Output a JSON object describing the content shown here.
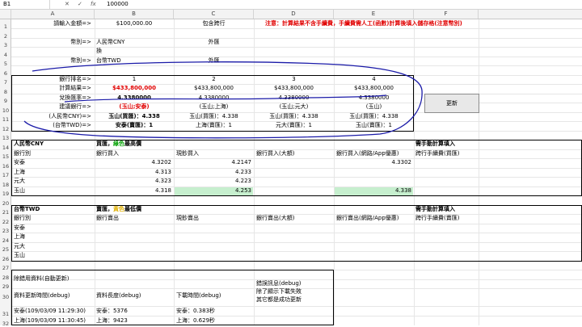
{
  "formula_bar": {
    "name_box": "B1",
    "value": "100000",
    "cancel": "✕",
    "enter": "✓",
    "fx": "fx"
  },
  "columns": [
    "A",
    "B",
    "C",
    "D",
    "E",
    "F"
  ],
  "rows": [
    "1",
    "2",
    "3",
    "4",
    "5",
    "6",
    "7",
    "8",
    "9",
    "10",
    "11",
    "12",
    "13",
    "14",
    "15",
    "16",
    "17",
    "18",
    "19",
    "20",
    "21",
    "22",
    "23",
    "24",
    "25",
    "26",
    "27",
    "28",
    "29",
    "30",
    "31",
    "32"
  ],
  "top": {
    "amount_label": "請輸入金額=>",
    "amount_value": "$100,000.00",
    "fee_note": "包含跨行",
    "warning": "注意：計算結果不含手續費，手續費需人工(函數)計算後填入儲存格(注意幣別)",
    "cur1_label": "幣別=>",
    "cur1_value": "人民幣CNY",
    "cur1_type": "外匯",
    "cur1_cont": "換",
    "cur2_label": "幣別=>",
    "cur2_value": "台幣TWD",
    "cur2_type": "外匯"
  },
  "rank": {
    "labels": [
      "銀行排名=>",
      "計算結果=>",
      "兌換匯率=>",
      "建議銀行=>",
      "(人民幣CNY)=>",
      "(台幣TWD)=>"
    ],
    "cols": [
      {
        "rank": "1",
        "result": "$433,800,000",
        "rate": "4.3380000",
        "bank": "(玉山;安泰)",
        "cny": "玉山(買匯)：4.338",
        "twd": "安泰(賣匯)：1"
      },
      {
        "rank": "2",
        "result": "$433,800,000",
        "rate": "4.3380000",
        "bank": "(玉山;上海)",
        "cny": "玉山(買匯)：4.338",
        "twd": "上海(賣匯)：1"
      },
      {
        "rank": "3",
        "result": "$433,800,000",
        "rate": "4.3380000",
        "bank": "(玉山;元大)",
        "cny": "玉山(買匯)：4.338",
        "twd": "元大(賣匯)：1"
      },
      {
        "rank": "4",
        "result": "$433,800,000",
        "rate": "4.3380000",
        "bank": "(玉山)",
        "cny": "玉山(買匯)：4.338",
        "twd": "玉山(賣匯)：1"
      }
    ],
    "refresh_button": "更新"
  },
  "cny": {
    "title": "人民幣CNY",
    "subtitle_a": "買匯，",
    "subtitle_b": "綠色",
    "subtitle_c": "最高價",
    "manual": "需手動計算填入",
    "headers": [
      "銀行別",
      "銀行買入",
      "現鈔買入",
      "銀行買入(大額)",
      "銀行買入(網路/App優惠)",
      "跨行手續費(買匯)"
    ],
    "banks": [
      {
        "name": "安泰",
        "b": "4.3202",
        "c": "4.2147",
        "d": "",
        "e": "4.3302"
      },
      {
        "name": "上海",
        "b": "4.313",
        "c": "4.233",
        "d": "",
        "e": ""
      },
      {
        "name": "元大",
        "b": "4.323",
        "c": "4.223",
        "d": "",
        "e": ""
      },
      {
        "name": "玉山",
        "b": "4.318",
        "c": "4.253",
        "d": "",
        "e": "4.338"
      }
    ]
  },
  "twd": {
    "title": "台幣TWD",
    "subtitle_a": "賣匯，",
    "subtitle_b": "黃色",
    "subtitle_c": "最低價",
    "manual": "需手動計算填入",
    "headers": [
      "銀行別",
      "銀行賣出",
      "現鈔賣出",
      "銀行賣出(大額)",
      "銀行賣出(網路/App優惠)",
      "跨行手續費(賣匯)"
    ],
    "banks": [
      "安泰",
      "上海",
      "元大",
      "玉山"
    ]
  },
  "debug": {
    "title": "除錯用資料(自動更新)",
    "h1": "資料更新時間(debug)",
    "h2": "資料長度(debug)",
    "h3": "下載時間(debug)",
    "err1": "錯誤訊息(debug)",
    "err2": "除了顯示下載失敗",
    "err3": "其它都是成功更新",
    "r31": [
      "安泰(109/03/09 11:29:30)",
      "安泰：5376",
      "安泰：0.383秒"
    ],
    "r32": [
      "上海(109/03/09 11:30:45)",
      "上海：9423",
      "上海：0.629秒"
    ]
  },
  "colors": {
    "green_fill": "#c6efce",
    "red_text": "#e00000",
    "green_text": "#00a000",
    "yellow_text": "#e0b000",
    "annotation": "#1a1aa8"
  }
}
